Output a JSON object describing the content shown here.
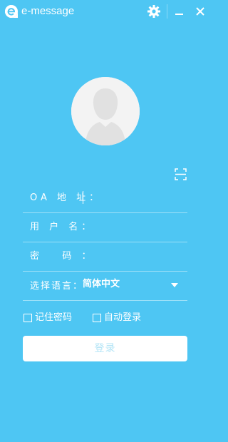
{
  "window": {
    "title": "e-message",
    "accent_color": "#4ec6f3",
    "icons": [
      "e-logo-icon",
      "gear-icon",
      "minimize-icon",
      "close-icon",
      "qr-scan-icon"
    ]
  },
  "form": {
    "oa_address_label": "OA 地 址：",
    "oa_address_value": "",
    "username_label": "用 户 名：",
    "username_value": "",
    "password_label": "密   码 ：",
    "password_value": "",
    "language_label": "选择语言：",
    "language_value": "简体中文"
  },
  "options": {
    "remember_password": "记住密码",
    "remember_password_checked": false,
    "auto_login": "自动登录",
    "auto_login_checked": false
  },
  "actions": {
    "login_label": "登录",
    "login_button_color": "#ffffff",
    "login_text_color": "#b2e4f6"
  }
}
